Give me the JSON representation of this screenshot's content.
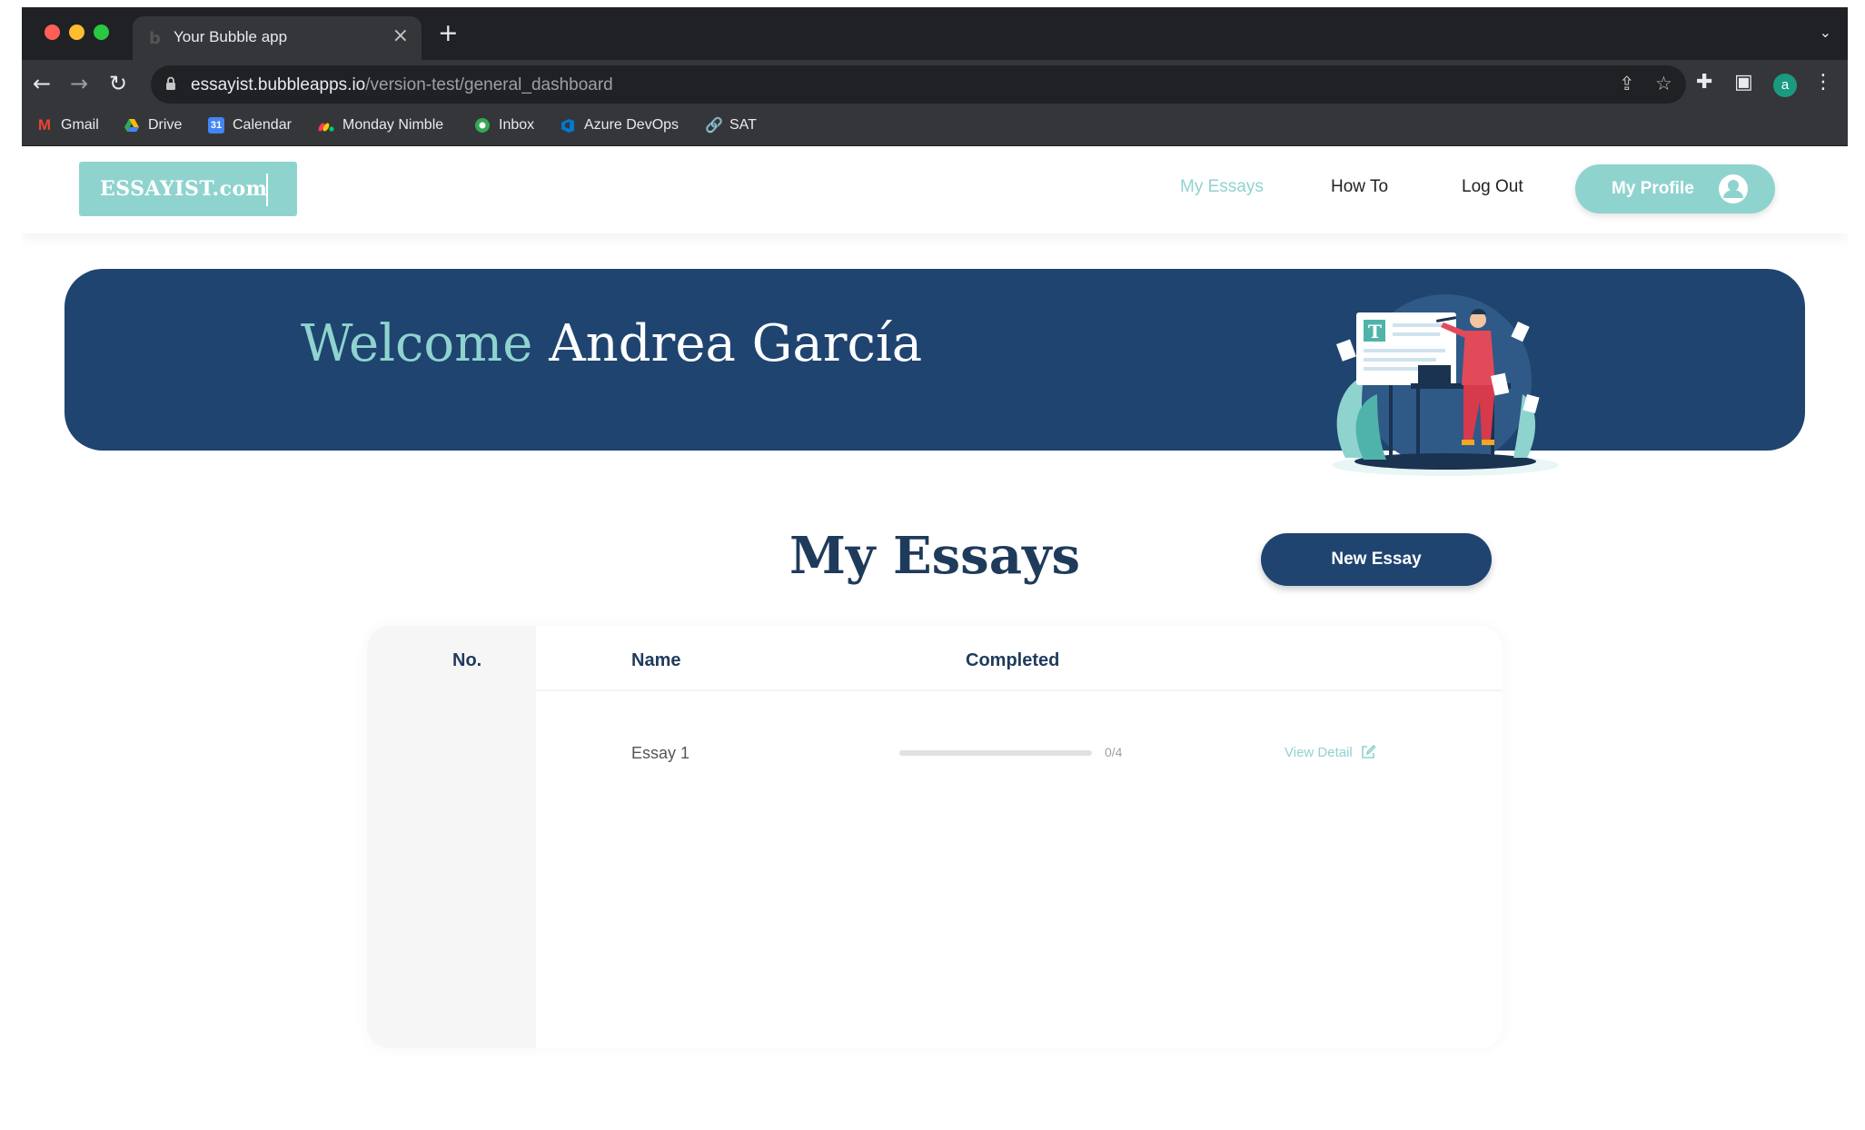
{
  "browser": {
    "tab_title": "Your Bubble app",
    "url_domain": "essayist.bubbleapps.io",
    "url_path": "/version-test/general_dashboard",
    "profile_initial": "a",
    "bookmarks": [
      {
        "label": "Gmail",
        "icon": "gmail-icon",
        "color": "#ea4335"
      },
      {
        "label": "Drive",
        "icon": "drive-icon",
        "color": "#fbbc04"
      },
      {
        "label": "Calendar",
        "icon": "calendar-icon",
        "color": "#4285f4"
      },
      {
        "label": "Monday Nimble",
        "icon": "monday-icon",
        "color": "#ff3d57"
      },
      {
        "label": "Inbox",
        "icon": "inbox-icon",
        "color": "#34a853"
      },
      {
        "label": "Azure DevOps",
        "icon": "azure-devops-icon",
        "color": "#0078d4"
      },
      {
        "label": "SAT",
        "icon": "link-icon",
        "color": "#5f6368"
      }
    ]
  },
  "app": {
    "logo_text": "ESSAYIST.com",
    "nav": {
      "my_essays": "My Essays",
      "how_to": "How To",
      "log_out": "Log Out",
      "profile": "My Profile"
    },
    "banner": {
      "greeting": "Welcome",
      "user_name": "Andrea García"
    },
    "essays": {
      "title": "My Essays",
      "new_button": "New Essay",
      "columns": {
        "no": "No.",
        "name": "Name",
        "completed": "Completed"
      },
      "rows": [
        {
          "no": "",
          "name": "Essay 1",
          "completed_text": "0/4",
          "completed_fraction": 0,
          "action": "View Detail"
        }
      ]
    }
  },
  "colors": {
    "accent_teal": "#8fd3cf",
    "brand_navy": "#1f4470",
    "heading_navy": "#1f3b5c"
  }
}
